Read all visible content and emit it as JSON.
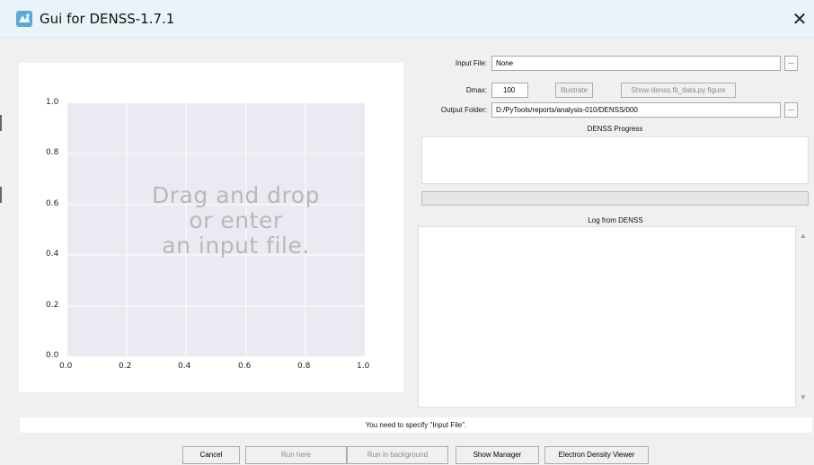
{
  "window": {
    "title": "Gui for DENSS-1.7.1",
    "close_glyph": "✕",
    "app_icon": "denss-app-icon"
  },
  "plot": {
    "y_ticks": [
      "1.0",
      "0.8",
      "0.6",
      "0.4",
      "0.2",
      "0.0"
    ],
    "x_ticks": [
      "0.0",
      "0.2",
      "0.4",
      "0.6",
      "0.8",
      "1.0"
    ],
    "placeholder_lines": [
      "Drag and drop",
      "or enter",
      "an input file."
    ],
    "background": "#eaeaf2",
    "grid_color": "#ffffff"
  },
  "form": {
    "input_file_label": "Input File:",
    "input_file_value": "None",
    "browse_label": "...",
    "dmax_label": "Dmax:",
    "dmax_value": "100",
    "illustrate_label": "Illustrate",
    "show_fit_label": "Show denss.fit_data.py figure",
    "output_folder_label": "Output Folder:",
    "output_folder_value": "D:/PyTools/reports/analysis-010/DENSS/000"
  },
  "progress": {
    "title": "DENSS Progress",
    "value": 0
  },
  "log": {
    "title": "Log from DENSS",
    "up_arrow": "▲",
    "down_arrow": "▼"
  },
  "status": {
    "message": "You need to specify \"Input File\"."
  },
  "buttons": {
    "cancel": "Cancel",
    "run_here": "Run here",
    "run_background": "Run in background",
    "show_manager": "Show Manager",
    "viewer": "Electron Density Viewer"
  },
  "colors": {
    "titlebar": "#eaf4f8",
    "disabled_text": "#8a8a8a"
  }
}
